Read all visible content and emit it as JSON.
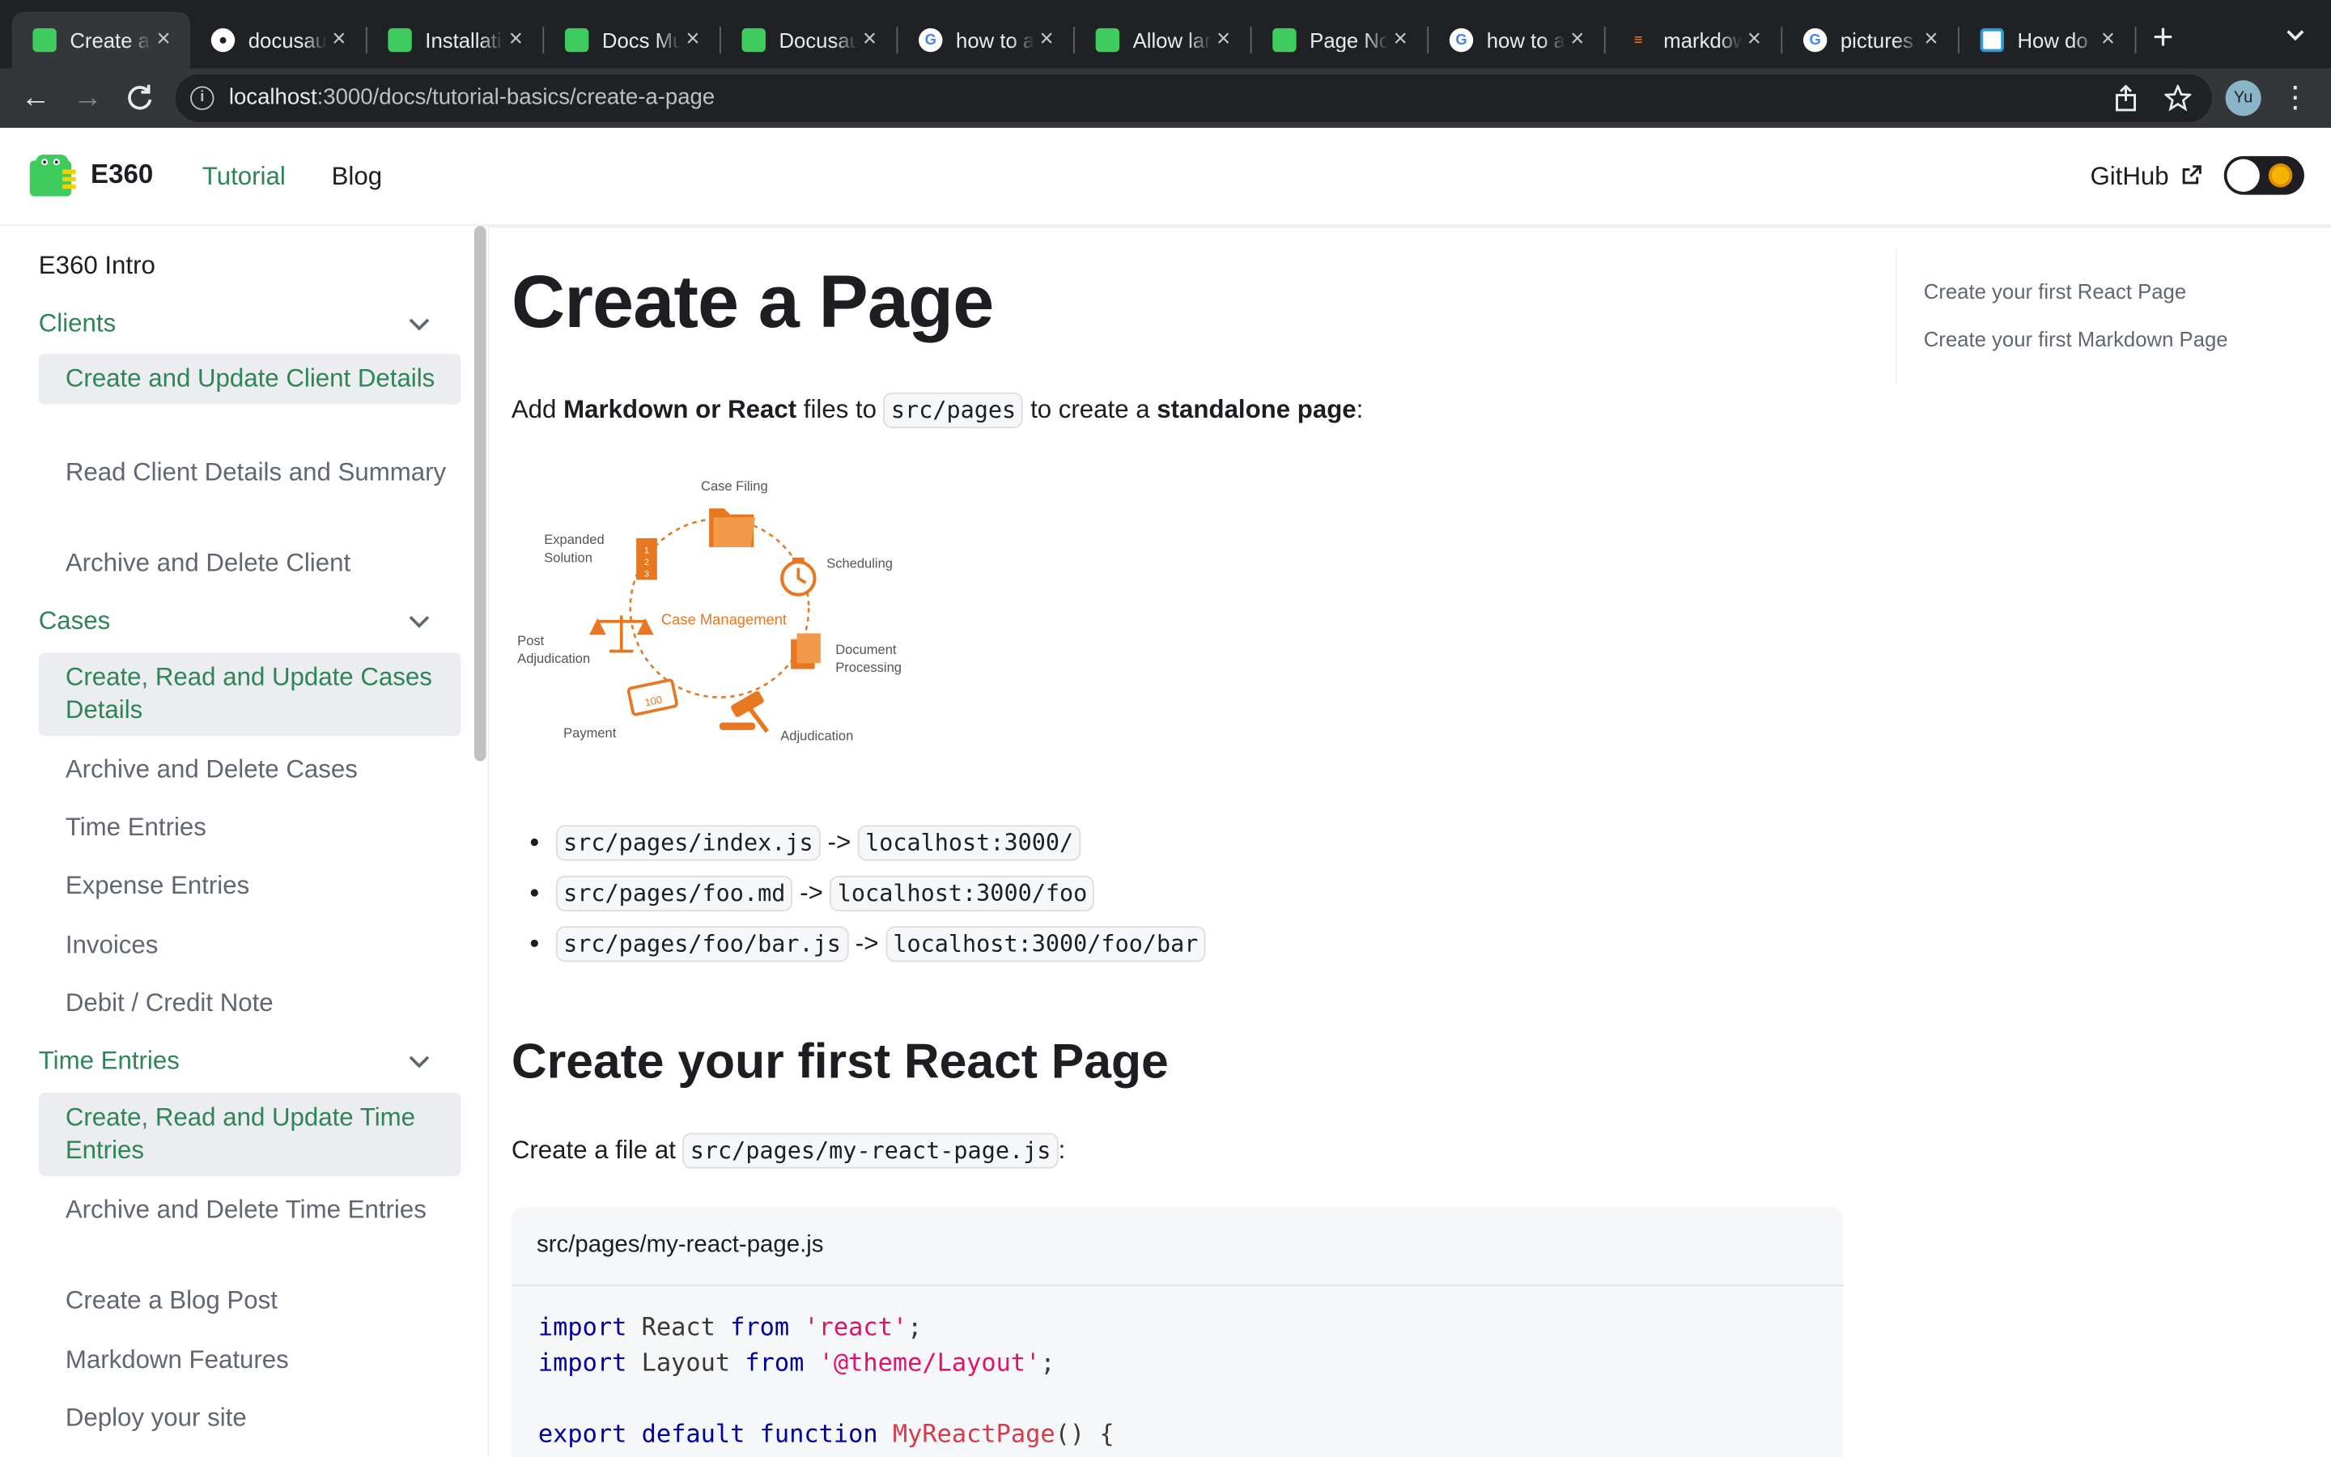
{
  "browser": {
    "tabs": [
      {
        "title": "Create a Page",
        "favicon": "docusaurus-dino-icon",
        "active": true
      },
      {
        "title": "docusaurus",
        "favicon": "github-icon"
      },
      {
        "title": "Installation",
        "favicon": "docusaurus-dino-icon"
      },
      {
        "title": "Docs Multi",
        "favicon": "docusaurus-dino-icon"
      },
      {
        "title": "Docusaurus",
        "favicon": "docusaurus-dino-icon"
      },
      {
        "title": "how to add",
        "favicon": "google-icon"
      },
      {
        "title": "Allow large",
        "favicon": "docusaurus-dino-icon"
      },
      {
        "title": "Page Not",
        "favicon": "docusaurus-dino-icon"
      },
      {
        "title": "how to add",
        "favicon": "google-icon"
      },
      {
        "title": "markdown",
        "favicon": "stackoverflow-icon"
      },
      {
        "title": "pictures",
        "favicon": "google-icon"
      },
      {
        "title": "How do",
        "favicon": "superuser-icon"
      }
    ],
    "new_tab_label": "+",
    "url_host": "localhost",
    "url_rest": ":3000/docs/tutorial-basics/create-a-page",
    "profile_initials": "Yu"
  },
  "site": {
    "brand": "E360",
    "nav_tutorial": "Tutorial",
    "nav_blog": "Blog",
    "github": "GitHub",
    "accent_color": "#2e8555"
  },
  "sidebar": {
    "items": [
      {
        "label": "E360 Intro",
        "kind": "link"
      },
      {
        "label": "Clients",
        "kind": "category"
      },
      {
        "label": "Create and Update Client Details",
        "kind": "sub",
        "selected": true
      },
      {
        "label": "Read Client Details and Summary",
        "kind": "sub"
      },
      {
        "label": "Archive and Delete Client",
        "kind": "sub"
      },
      {
        "label": "Cases",
        "kind": "category"
      },
      {
        "label": "Create, Read and Update Cases Details",
        "kind": "sub",
        "selected": true
      },
      {
        "label": "Archive and Delete Cases",
        "kind": "sub"
      },
      {
        "label": "Time Entries",
        "kind": "sub"
      },
      {
        "label": "Expense Entries",
        "kind": "sub"
      },
      {
        "label": "Invoices",
        "kind": "sub"
      },
      {
        "label": "Debit / Credit Note",
        "kind": "sub"
      },
      {
        "label": "Time Entries",
        "kind": "category"
      },
      {
        "label": "Create, Read and Update Time Entries",
        "kind": "sub",
        "selected": true
      },
      {
        "label": "Archive and Delete Time Entries",
        "kind": "sub"
      },
      {
        "label": "Create a Blog Post",
        "kind": "sub"
      },
      {
        "label": "Markdown Features",
        "kind": "sub"
      },
      {
        "label": "Deploy your site",
        "kind": "sub"
      }
    ]
  },
  "content": {
    "title": "Create a Page",
    "intro": {
      "p1": "Add ",
      "b1": "Markdown or React",
      "p2": " files to ",
      "code": "src/pages",
      "p3": " to create a ",
      "b2": "standalone page",
      "p4": ":"
    },
    "diagram": {
      "center": "Case Management",
      "nodes": {
        "case_filing": "Case Filing",
        "scheduling": "Scheduling",
        "document_processing_1": "Document",
        "document_processing_2": "Processing",
        "adjudication": "Adjudication",
        "payment": "Payment",
        "post_adjudication_1": "Post",
        "post_adjudication_2": "Adjudication",
        "expanded_solution_1": "Expanded",
        "expanded_solution_2": "Solution"
      },
      "accent_color": "#e87722"
    },
    "routes": [
      {
        "src": "src/pages/index.js",
        "arrow": "->",
        "dst": "localhost:3000/"
      },
      {
        "src": "src/pages/foo.md",
        "arrow": "->",
        "dst": "localhost:3000/foo"
      },
      {
        "src": "src/pages/foo/bar.js",
        "arrow": "->",
        "dst": "localhost:3000/foo/bar"
      }
    ],
    "section_title": "Create your first React Page",
    "section_intro": "Create a file at ",
    "section_code": "src/pages/my-react-page.js",
    "section_colon": ":",
    "codeblock": {
      "filename": "src/pages/my-react-page.js",
      "line1": {
        "kw1": "import",
        "mid": " React ",
        "kw2": "from",
        "str": "'react'",
        "end": ";"
      },
      "line2": {
        "kw1": "import",
        "mid": " Layout ",
        "kw2": "from",
        "str": "'@theme/Layout'",
        "end": ";"
      },
      "line4": {
        "kw1": "export",
        "kw2": "default",
        "kw3": "function",
        "fn": "MyReactPage",
        "end": "() {"
      }
    }
  },
  "toc": {
    "items": [
      "Create your first React Page",
      "Create your first Markdown Page"
    ]
  }
}
